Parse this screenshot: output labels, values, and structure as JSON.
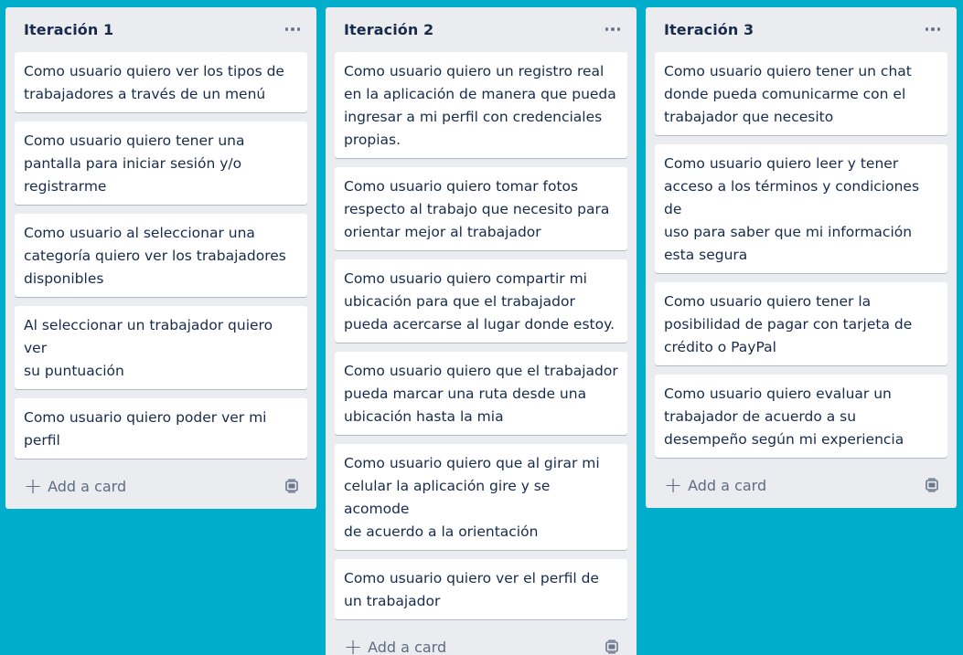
{
  "board": {
    "lists": [
      {
        "title": "Iteración 1",
        "cards": [
          {
            "lines": [
              "Como usuario quiero ver los tipos de",
              "trabajadores a través de un menú"
            ]
          },
          {
            "lines": [
              "Como usuario quiero tener una",
              "pantalla para iniciar sesión y/o",
              "registrarme"
            ]
          },
          {
            "lines": [
              "Como usuario al seleccionar una",
              "categoría quiero ver los trabajadores",
              "disponibles"
            ]
          },
          {
            "lines": [
              "Al seleccionar un trabajador quiero ver",
              "su puntuación"
            ]
          },
          {
            "lines": [
              "Como usuario quiero poder ver mi",
              "perfil"
            ]
          }
        ],
        "add_label": "Add a card"
      },
      {
        "title": "Iteración 2",
        "cards": [
          {
            "lines": [
              "Como usuario quiero un registro real",
              "en la aplicación de manera que pueda",
              "ingresar a mi perfil con credenciales",
              "propias."
            ]
          },
          {
            "lines": [
              "Como usuario quiero tomar fotos",
              "respecto al trabajo que necesito para",
              "orientar mejor al trabajador"
            ]
          },
          {
            "lines": [
              "Como usuario quiero compartir mi",
              "ubicación para que el trabajador",
              "pueda acercarse al lugar donde estoy."
            ]
          },
          {
            "lines": [
              "Como usuario quiero que el trabajador",
              "pueda marcar una ruta desde una",
              "ubicación hasta la mia"
            ]
          },
          {
            "lines": [
              "Como usuario quiero que al girar mi",
              "celular la aplicación gire y se acomode",
              "de acuerdo a la orientación"
            ]
          },
          {
            "lines": [
              "Como usuario quiero ver el perfil de",
              "un trabajador"
            ]
          }
        ],
        "add_label": "Add a card"
      },
      {
        "title": "Iteración 3",
        "cards": [
          {
            "lines": [
              "Como usuario quiero tener un chat",
              "donde pueda comunicarme con el",
              "trabajador que necesito"
            ]
          },
          {
            "lines": [
              "Como usuario quiero leer y tener",
              "acceso a los términos y condiciones de",
              "uso para saber que mi información",
              "esta segura"
            ]
          },
          {
            "lines": [
              "Como usuario quiero tener la",
              "posibilidad de pagar con tarjeta de",
              "crédito o PayPal"
            ]
          },
          {
            "lines": [
              "Como usuario quiero evaluar un",
              "trabajador de acuerdo a su",
              "desempeño según mi experiencia"
            ]
          }
        ],
        "add_label": "Add a card"
      }
    ]
  },
  "icons": {
    "list_menu": "more-horizontal-icon",
    "add": "plus-icon",
    "template": "card-template-icon"
  },
  "colors": {
    "board_background": "#00AECC",
    "list_background": "#EBECF0",
    "card_background": "#FFFFFF",
    "text": "#172B4D",
    "muted": "#5E6C84"
  }
}
